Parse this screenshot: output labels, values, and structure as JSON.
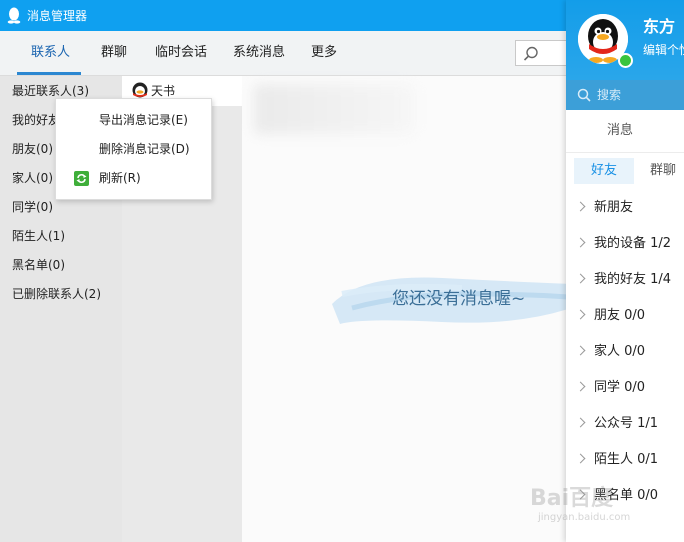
{
  "manager": {
    "title": "消息管理器",
    "tabs": [
      "联系人",
      "群聊",
      "临时会话",
      "系统消息",
      "更多"
    ],
    "categories": [
      "最近联系人(3)",
      "我的好友",
      "朋友(0)",
      "家人(0)",
      "同学(0)",
      "陌生人(1)",
      "黑名单(0)",
      "已删除联系人(2)"
    ],
    "selected_contact": "天书",
    "empty_message": "您还没有消息喔~",
    "context_menu": [
      "导出消息记录(E)",
      "删除消息记录(D)",
      "刷新(R)"
    ]
  },
  "qq": {
    "nickname": "东方",
    "signature": "编辑个性",
    "search_placeholder": "搜索",
    "tab_messages": "消息",
    "subtab_friends": "好友",
    "subtab_groups": "群聊",
    "groups": [
      "新朋友",
      "我的设备 1/2",
      "我的好友 1/4",
      "朋友 0/0",
      "家人 0/0",
      "同学 0/0",
      "公众号 1/1",
      "陌生人 0/1",
      "黑名单 0/0"
    ]
  },
  "watermark": {
    "brand": "Bai百度",
    "sub": "jingyan.baidu.com"
  },
  "colors": {
    "titlebar": "#0fa0f0",
    "accent": "#2b87d1",
    "online": "#39c43e"
  }
}
